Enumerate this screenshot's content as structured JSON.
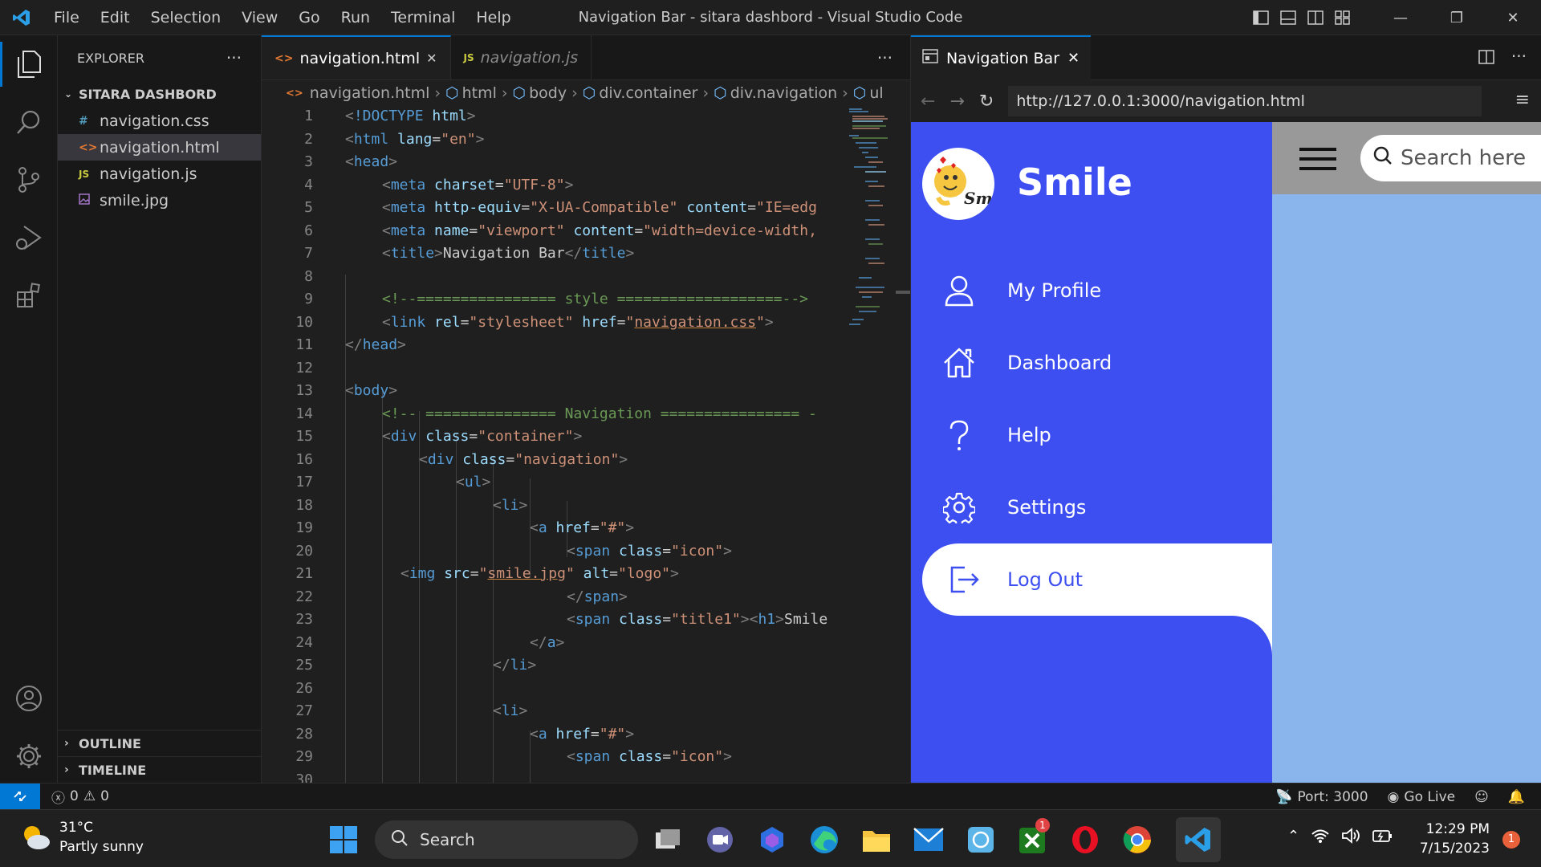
{
  "window": {
    "title": "Navigation Bar - sitara dashbord - Visual Studio Code"
  },
  "menu": [
    "File",
    "Edit",
    "Selection",
    "View",
    "Go",
    "Run",
    "Terminal",
    "Help"
  ],
  "explorer": {
    "header": "EXPLORER",
    "folder": "SITARA DASHBORD",
    "files": [
      {
        "name": "navigation.css",
        "icon": "#"
      },
      {
        "name": "navigation.html",
        "icon": "<>"
      },
      {
        "name": "navigation.js",
        "icon": "JS"
      },
      {
        "name": "smile.jpg",
        "icon": "image-icon"
      }
    ],
    "outline": "OUTLINE",
    "timeline": "TIMELINE"
  },
  "editor": {
    "tabs": [
      {
        "label": "navigation.html",
        "icon": "<>"
      },
      {
        "label": "navigation.js",
        "icon": "JS"
      }
    ],
    "breadcrumbs": [
      "navigation.html",
      "html",
      "body",
      "div.container",
      "div.navigation",
      "ul"
    ],
    "line_numbers": [
      "1",
      "2",
      "3",
      "4",
      "5",
      "6",
      "7",
      "8",
      "9",
      "10",
      "11",
      "12",
      "13",
      "14",
      "15",
      "16",
      "17",
      "18",
      "19",
      "20",
      "21",
      "22",
      "23",
      "24",
      "25",
      "26",
      "27",
      "28",
      "29",
      "30"
    ]
  },
  "preview": {
    "tab_label": "Navigation Bar",
    "url": "http://127.0.0.1:3000/navigation.html",
    "brand": "Smile",
    "logo_text": "Sm",
    "search_placeholder": "Search here",
    "nav_items": [
      {
        "label": "My Profile",
        "icon": "person-icon"
      },
      {
        "label": "Dashboard",
        "icon": "home-icon"
      },
      {
        "label": "Help",
        "icon": "question-icon"
      },
      {
        "label": "Settings",
        "icon": "gear-icon"
      },
      {
        "label": "Log Out",
        "icon": "logout-icon"
      }
    ]
  },
  "status": {
    "errors": "0",
    "warnings": "0",
    "port": "Port: 3000",
    "golive": "Go Live"
  },
  "taskbar": {
    "temp": "31°C",
    "weather": "Partly sunny",
    "search": "Search",
    "time": "12:29 PM",
    "date": "7/15/2023",
    "notif_count": "1",
    "xbox_badge": "1"
  },
  "colors": {
    "accent": "#0078d4",
    "nav_bg": "#3d4ff0",
    "page_bg": "#8ab4ec"
  }
}
